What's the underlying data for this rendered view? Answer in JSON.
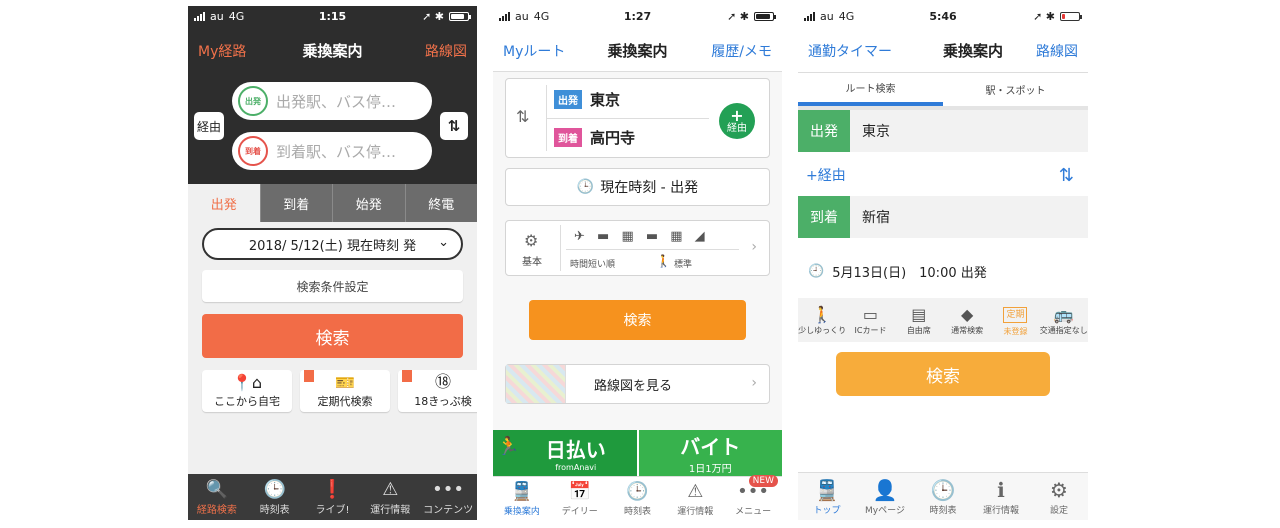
{
  "phone1": {
    "status": {
      "carrier": "au",
      "network": "4G",
      "time": "1:15",
      "icons": "➚ ✱"
    },
    "nav": {
      "left": "My経路",
      "title": "乗換案内",
      "right": "路線図"
    },
    "from_badge": "出発",
    "to_badge": "到着",
    "from_placeholder": "出発駅、バス停…",
    "to_placeholder": "到着駅、バス停…",
    "via_button": "経由",
    "swap_icon": "swap-icon",
    "segments": [
      "出発",
      "到着",
      "始発",
      "終電"
    ],
    "date_select": "2018/ 5/12(土) 現在時刻 発",
    "conditions_button": "検索条件設定",
    "search_button": "検索",
    "quick": [
      {
        "label": "ここから自宅",
        "icon": "📍⌂"
      },
      {
        "label": "定期代検索",
        "icon": "🎫"
      },
      {
        "label": "18きっぷ検",
        "icon": "⑱"
      }
    ],
    "tabs": [
      {
        "label": "経路検索",
        "icon": "🔍"
      },
      {
        "label": "時刻表",
        "icon": "🕒"
      },
      {
        "label": "ライブ!",
        "icon": "❗"
      },
      {
        "label": "運行情報",
        "icon": "⚠"
      },
      {
        "label": "コンテンツ",
        "icon": "•••"
      }
    ],
    "accent": "#f0714a"
  },
  "phone2": {
    "status": {
      "carrier": "au",
      "network": "4G",
      "time": "1:27",
      "icons": "➚ ✱"
    },
    "nav": {
      "left": "Myルート",
      "title": "乗換案内",
      "right": "履歴/メモ"
    },
    "from_tag": "出発",
    "from_station": "東京",
    "to_tag": "到着",
    "to_station": "高円寺",
    "via_plus": "+",
    "via_label": "経由",
    "time_button": "現在時刻 - 出発",
    "basic_label": "基本",
    "transport_icons": "✈ ▬ ▦ ▬ ▦ ◢",
    "sort_label": "時間短い順",
    "walk_label": "標準",
    "search_button": "検索",
    "map_button": "路線図を見る",
    "ad": {
      "left": "日払い",
      "left_sub": "fromAnavi",
      "right": "バイト",
      "right_sub": "1日1万円"
    },
    "new_badge": "NEW",
    "tabs": [
      {
        "label": "乗換案内",
        "icon": "🚆"
      },
      {
        "label": "デイリー",
        "icon": "📅"
      },
      {
        "label": "時刻表",
        "icon": "🕒"
      },
      {
        "label": "運行情報",
        "icon": "⚠"
      },
      {
        "label": "メニュー",
        "icon": "•••"
      }
    ],
    "accent": "#2f7bd8"
  },
  "phone3": {
    "status": {
      "carrier": "au",
      "network": "4G",
      "time": "5:46",
      "icons": "➚ ✱"
    },
    "nav": {
      "left": "通勤タイマー",
      "title": "乗換案内",
      "right": "路線図"
    },
    "segments": [
      "ルート検索",
      "駅・スポット"
    ],
    "from_label": "出発",
    "from_station": "東京",
    "via_label": "+経由",
    "to_label": "到着",
    "to_station": "新宿",
    "date": "5月13日(日)　10:00 出発",
    "options": [
      {
        "label": "少しゆっくり",
        "icon": "🚶"
      },
      {
        "label": "ICカード",
        "icon": "▭"
      },
      {
        "label": "自由席",
        "icon": "▤"
      },
      {
        "label": "通常検索",
        "icon": "◆"
      },
      {
        "label": "未登録",
        "icon": "定期"
      },
      {
        "label": "交通指定なし",
        "icon": "🚌"
      }
    ],
    "search_button": "検索",
    "tabs": [
      {
        "label": "トップ",
        "icon": "🚆"
      },
      {
        "label": "Myページ",
        "icon": "👤"
      },
      {
        "label": "時刻表",
        "icon": "🕒"
      },
      {
        "label": "運行情報",
        "icon": "ℹ"
      },
      {
        "label": "設定",
        "icon": "⚙"
      }
    ],
    "accent": "#2f7bd8"
  }
}
